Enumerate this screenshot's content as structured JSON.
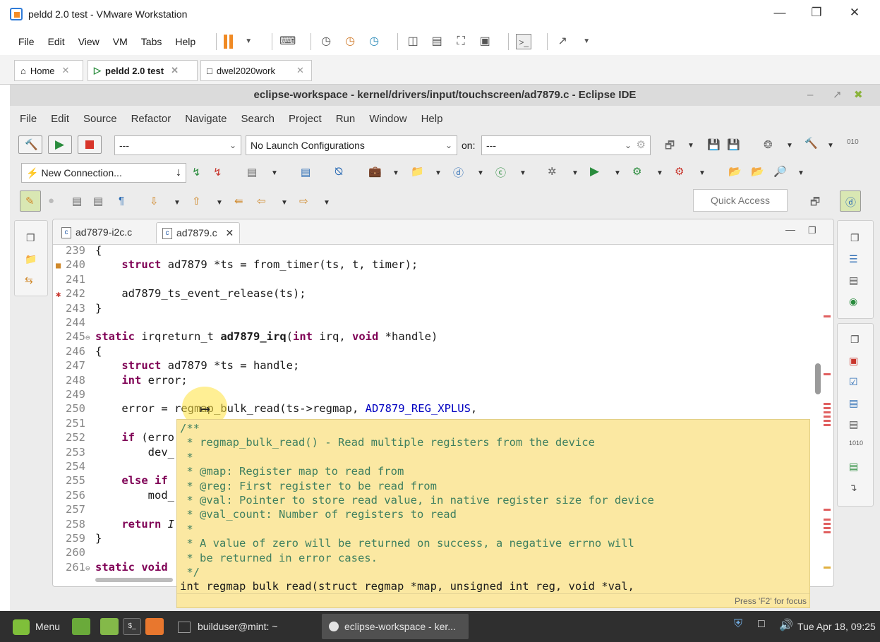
{
  "vm": {
    "title": "peldd 2.0 test - VMware Workstation",
    "menu": [
      "File",
      "Edit",
      "View",
      "VM",
      "Tabs",
      "Help"
    ],
    "tabs": [
      {
        "label": "Home"
      },
      {
        "label": "peldd 2.0 test"
      },
      {
        "label": "dwel2020work"
      }
    ]
  },
  "eclipse": {
    "title": "eclipse-workspace - kernel/drivers/input/touchscreen/ad7879.c - Eclipse IDE",
    "menu": [
      "File",
      "Edit",
      "Source",
      "Refactor",
      "Navigate",
      "Search",
      "Project",
      "Run",
      "Window",
      "Help"
    ],
    "toolbar": {
      "mode_combo": "---",
      "launch_combo": "No Launch Configurations",
      "on_label": "on:",
      "target_combo": "---",
      "new_connection": "New Connection...",
      "quick_access_placeholder": "Quick Access"
    },
    "editor_tabs": [
      {
        "label": "ad7879-i2c.c",
        "active": false
      },
      {
        "label": "ad7879.c",
        "active": true
      }
    ],
    "code_lines": [
      {
        "n": "239",
        "text": "{"
      },
      {
        "n": "240",
        "text": "    struct ad7879 *ts = from_timer(ts, t, timer);"
      },
      {
        "n": "241",
        "text": ""
      },
      {
        "n": "242",
        "text": "    ad7879_ts_event_release(ts);"
      },
      {
        "n": "243",
        "text": "}"
      },
      {
        "n": "244",
        "text": ""
      },
      {
        "n": "245",
        "text": "static irqreturn_t ad7879_irq(int irq, void *handle)"
      },
      {
        "n": "246",
        "text": "{"
      },
      {
        "n": "247",
        "text": "    struct ad7879 *ts = handle;"
      },
      {
        "n": "248",
        "text": "    int error;"
      },
      {
        "n": "249",
        "text": ""
      },
      {
        "n": "250",
        "text": "    error = regmap_bulk_read(ts->regmap, AD7879_REG_XPLUS,"
      },
      {
        "n": "251",
        "text": ""
      },
      {
        "n": "252",
        "text": "    if (erro"
      },
      {
        "n": "253",
        "text": "        dev_"
      },
      {
        "n": "254",
        "text": ""
      },
      {
        "n": "255",
        "text": "    else if"
      },
      {
        "n": "256",
        "text": "        mod_"
      },
      {
        "n": "257",
        "text": ""
      },
      {
        "n": "258",
        "text": "    return I"
      },
      {
        "n": "259",
        "text": "}"
      },
      {
        "n": "260",
        "text": ""
      },
      {
        "n": "261",
        "text": "static void"
      }
    ],
    "tooltip": {
      "lines": [
        "/**",
        " * regmap_bulk_read() - Read multiple registers from the device",
        " *",
        " * @map: Register map to read from",
        " * @reg: First register to be read from",
        " * @val: Pointer to store read value, in native register size for device",
        " * @val_count: Number of registers to read",
        " *",
        " * A value of zero will be returned on success, a negative errno will",
        " * be returned in error cases.",
        " */"
      ],
      "signature": "int regmap bulk read(struct regmap *map, unsigned int reg, void *val,",
      "focus_hint": "Press 'F2' for focus"
    }
  },
  "taskbar": {
    "menu": "Menu",
    "terminal": "builduser@mint: ~",
    "eclipse": "eclipse-workspace - ker...",
    "clock": "Tue Apr 18, 09:25"
  }
}
